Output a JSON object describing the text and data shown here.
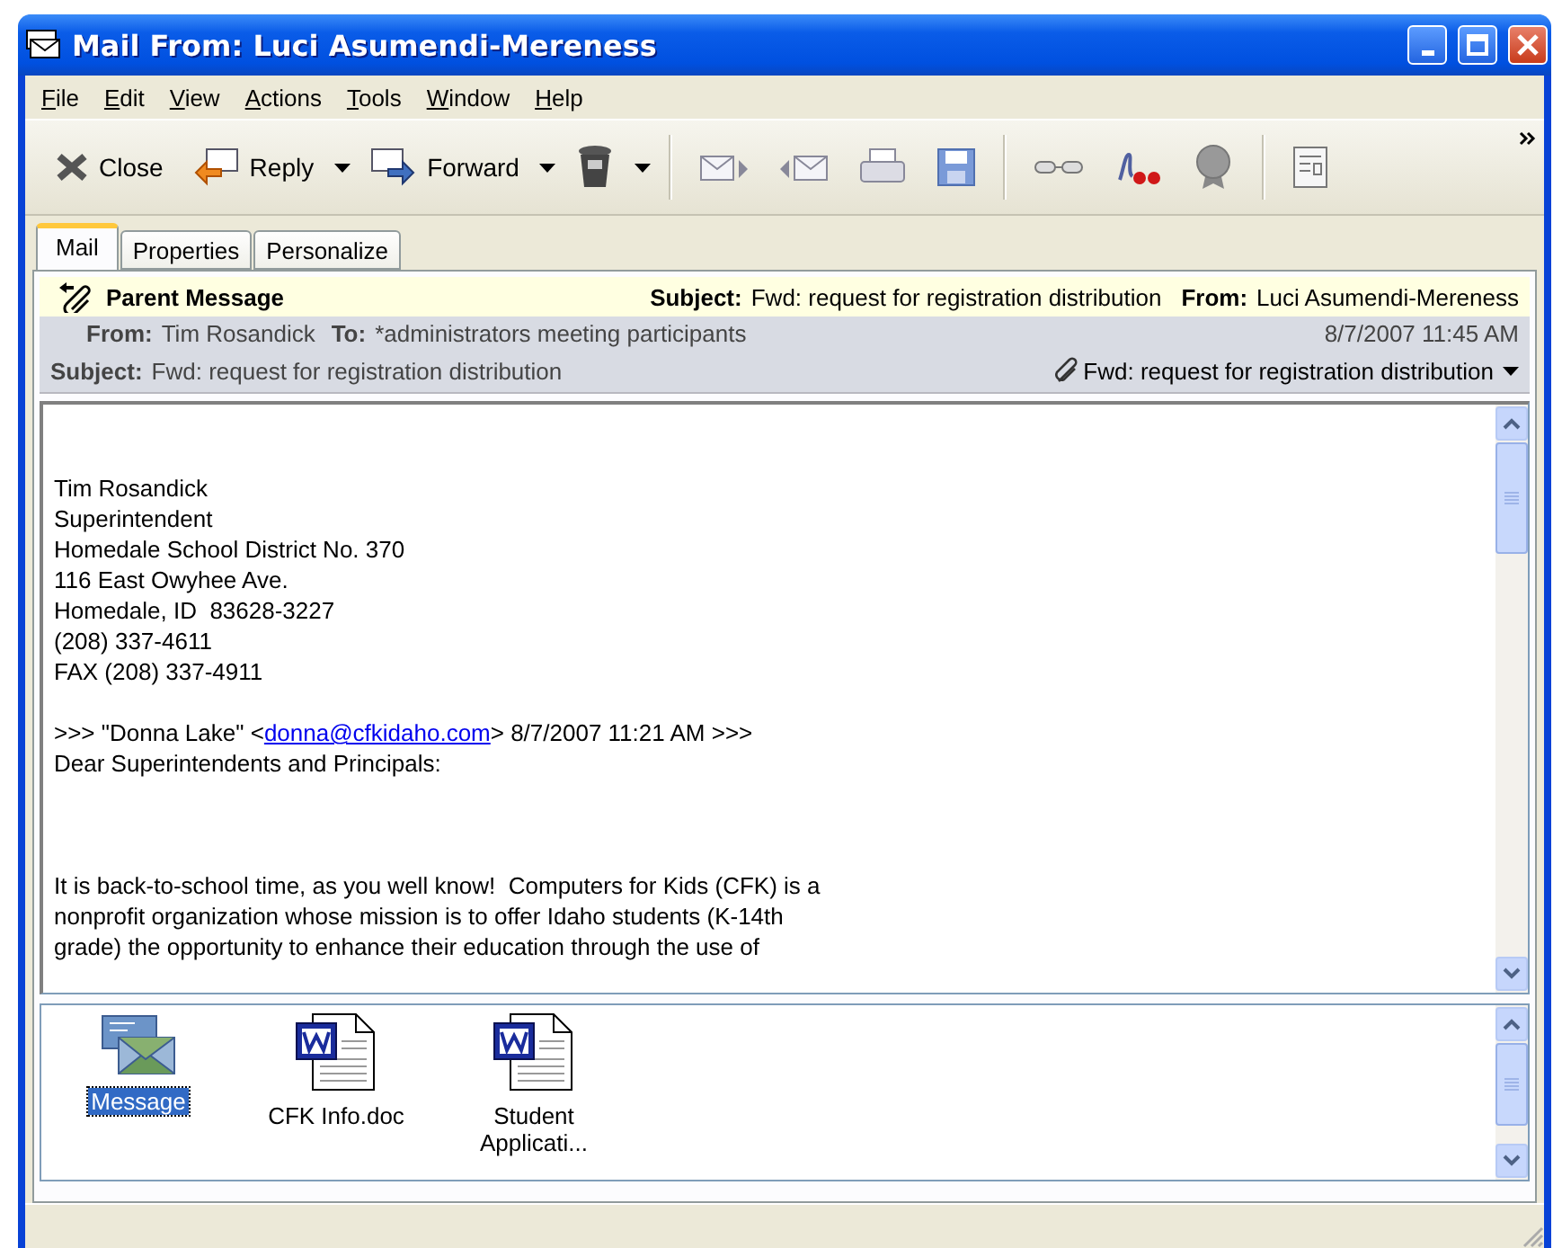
{
  "window": {
    "title": "Mail From: Luci Asumendi-Mereness"
  },
  "menu": [
    {
      "label": "File",
      "first_letter_underlined": true
    },
    {
      "label": "Edit",
      "first_letter_underlined": true
    },
    {
      "label": "View",
      "first_letter_underlined": true
    },
    {
      "label": "Actions",
      "first_letter_underlined": true
    },
    {
      "label": "Tools",
      "first_letter_underlined": true
    },
    {
      "label": "Window",
      "first_letter_underlined": true
    },
    {
      "label": "Help",
      "first_letter_underlined": true
    }
  ],
  "toolbar": [
    {
      "kind": "labeled",
      "label": "Close"
    },
    {
      "kind": "labeled",
      "label": "Reply",
      "dropdown": true
    },
    {
      "kind": "labeled",
      "label": "Forward",
      "dropdown": true
    },
    {
      "kind": "icon",
      "dropdown": true
    },
    {
      "kind": "separator"
    },
    {
      "kind": "icon"
    },
    {
      "kind": "icon"
    },
    {
      "kind": "icon"
    },
    {
      "kind": "icon"
    },
    {
      "kind": "separator"
    },
    {
      "kind": "icon"
    },
    {
      "kind": "icon"
    },
    {
      "kind": "icon"
    },
    {
      "kind": "separator"
    },
    {
      "kind": "icon"
    }
  ],
  "tabs": [
    {
      "label": "Mail",
      "selected": true
    },
    {
      "label": "Properties",
      "selected": false
    },
    {
      "label": "Personalize",
      "selected": false
    }
  ],
  "header": {
    "parent": {
      "title": "Parent Message",
      "subject_label": "Subject:",
      "subject": "Fwd: request for registration distribution",
      "from_label": "From:",
      "from": "Luci Asumendi-Mereness"
    },
    "from_label": "From:",
    "from": "Tim Rosandick",
    "to_label": "To:",
    "to": "*administrators meeting participants",
    "date": "8/7/2007 11:45 AM",
    "subject_label": "Subject:",
    "subject": "Fwd: request for registration distribution",
    "attachment": "Fwd: request for registration distribution"
  },
  "body": [
    {
      "kind": "blank"
    },
    {
      "kind": "blank"
    },
    {
      "kind": "text",
      "text": "Tim Rosandick"
    },
    {
      "kind": "text",
      "text": "Superintendent"
    },
    {
      "kind": "text",
      "text": "Homedale School District No. 370"
    },
    {
      "kind": "text",
      "text": "116 East Owyhee Ave."
    },
    {
      "kind": "text",
      "text": "Homedale, ID  83628-3227"
    },
    {
      "kind": "text",
      "text": "(208) 337-4611"
    },
    {
      "kind": "text",
      "text": "FAX (208) 337-4911"
    },
    {
      "kind": "blank"
    },
    {
      "kind": "link_line",
      "before": ">>> \"Donna Lake\" <",
      "link": "donna@cfkidaho.com",
      "after": "> 8/7/2007 11:21 AM >>>"
    },
    {
      "kind": "text",
      "text": "Dear Superintendents and Principals:"
    },
    {
      "kind": "blank"
    },
    {
      "kind": "blank"
    },
    {
      "kind": "blank"
    },
    {
      "kind": "text",
      "text": "It is back-to-school time, as you well know!  Computers for Kids (CFK) is a"
    },
    {
      "kind": "text",
      "text": "nonprofit organization whose mission is to offer Idaho students (K-14th"
    },
    {
      "kind": "text",
      "text": "grade) the opportunity to enhance their education through the use of"
    }
  ],
  "attachments": [
    {
      "kind": "message",
      "label": "Message",
      "selected": true
    },
    {
      "kind": "document",
      "label": "CFK Info.doc",
      "selected": false
    },
    {
      "kind": "document",
      "label": "Student Applicati...",
      "selected": false
    }
  ]
}
